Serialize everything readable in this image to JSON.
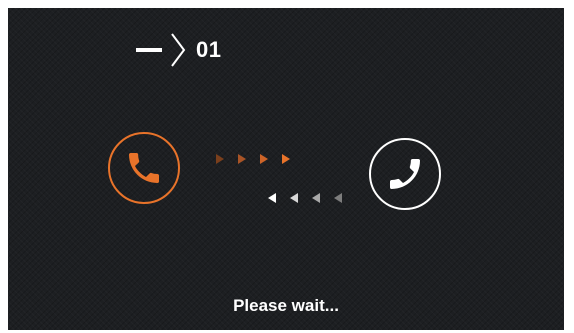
{
  "screen": {
    "channel_label": "01",
    "status_text": "Please wait...",
    "colors": {
      "caller_accent": "#e8732a",
      "callee_accent": "#ffffff",
      "background": "#1d1f22"
    },
    "icons": {
      "back": "dash-icon",
      "separator": "chevron-right-icon",
      "caller": "phone-handset-icon",
      "callee": "phone-handset-icon",
      "outgoing_arrows": "triangle-right-icon",
      "incoming_arrows": "triangle-left-icon"
    }
  }
}
